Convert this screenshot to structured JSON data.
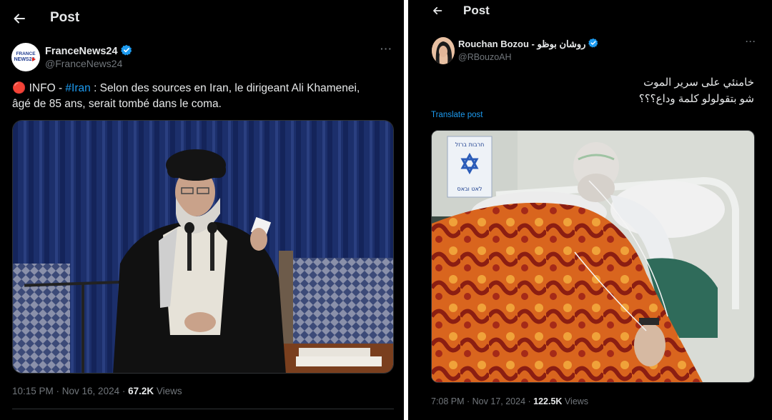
{
  "left_post": {
    "header": {
      "title": "Post"
    },
    "author": {
      "name": "FranceNews24",
      "handle": "@FranceNews24",
      "avatar_text_line1": "FRANCE",
      "avatar_text_line2": "NEWS24"
    },
    "text": {
      "bullet": "🔴",
      "prefix": " INFO - ",
      "hashtag": "#Iran",
      "line1_rest": " : Selon des sources en Iran, le dirigeant Ali Khamenei,",
      "line2": "âgé de 85 ans, serait tombé dans le coma."
    },
    "meta": {
      "timestamp": "10:15 PM · Nov 16, 2024 · ",
      "views_count": "67.2K",
      "views_label": " Views"
    }
  },
  "right_post": {
    "header": {
      "title": "Post"
    },
    "author": {
      "name": "Rouchan Bozou - روشان بوظو",
      "handle": "@RBouzoAH"
    },
    "text": {
      "line1": "خامنئي على سرير الموت",
      "line2": "شو بتقولولو كلمة وداع؟؟؟"
    },
    "translate_label": "Translate post",
    "sign_text_top": "חרבות ברזל",
    "sign_text_bottom": "לאט ובאס",
    "meta": {
      "timestamp": "7:08 PM · Nov 17, 2024 · ",
      "views_count": "122.5K",
      "views_label": " Views"
    }
  },
  "colors": {
    "background": "#000000",
    "text": "#e7e9ea",
    "muted": "#71767b",
    "accent": "#1d9bf0"
  },
  "icons": [
    "back-arrow-icon",
    "verified-badge-icon",
    "more-options-icon"
  ]
}
